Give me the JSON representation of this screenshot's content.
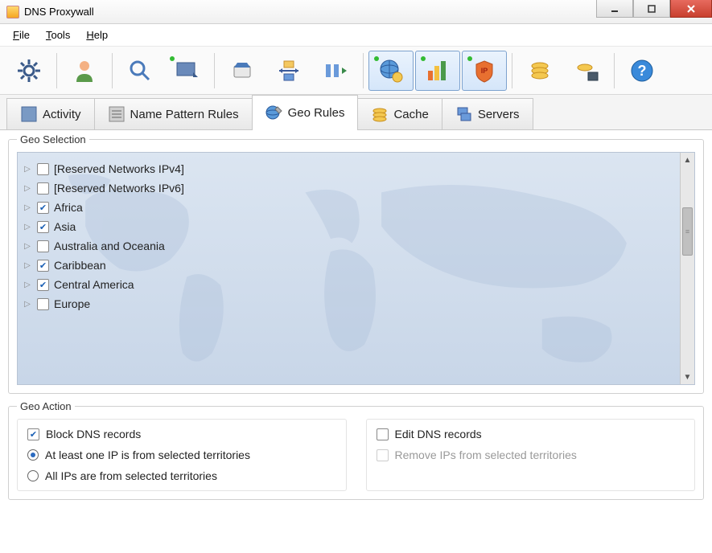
{
  "window": {
    "title": "DNS Proxywall"
  },
  "menu": {
    "file": "File",
    "tools": "Tools",
    "help": "Help"
  },
  "toolbar_icons": [
    "settings",
    "user",
    "search",
    "monitor",
    "eraser",
    "network",
    "ports",
    "globe-coins",
    "chart-coins",
    "ip-shield",
    "coins",
    "disk-coins",
    "help"
  ],
  "tabs": [
    {
      "id": "activity",
      "label": "Activity"
    },
    {
      "id": "name-pattern",
      "label": "Name Pattern Rules"
    },
    {
      "id": "geo-rules",
      "label": "Geo Rules"
    },
    {
      "id": "cache",
      "label": "Cache"
    },
    {
      "id": "servers",
      "label": "Servers"
    }
  ],
  "active_tab": "geo-rules",
  "geo_selection": {
    "legend": "Geo Selection",
    "items": [
      {
        "label": "[Reserved Networks IPv4]",
        "checked": false
      },
      {
        "label": "[Reserved Networks IPv6]",
        "checked": false
      },
      {
        "label": "Africa",
        "checked": true
      },
      {
        "label": "Asia",
        "checked": true
      },
      {
        "label": "Australia and Oceania",
        "checked": false
      },
      {
        "label": "Caribbean",
        "checked": true
      },
      {
        "label": "Central America",
        "checked": true
      },
      {
        "label": "Europe",
        "checked": false
      }
    ]
  },
  "geo_action": {
    "legend": "Geo Action",
    "block_dns": {
      "label": "Block DNS records",
      "checked": true
    },
    "edit_dns": {
      "label": "Edit DNS records",
      "checked": false
    },
    "radio_at_least": {
      "label": "At least one IP is from selected territories",
      "selected": true
    },
    "radio_all": {
      "label": "All IPs are from selected territories",
      "selected": false
    },
    "remove_ips": {
      "label": "Remove IPs from selected territories",
      "checked": false,
      "disabled": true
    }
  }
}
